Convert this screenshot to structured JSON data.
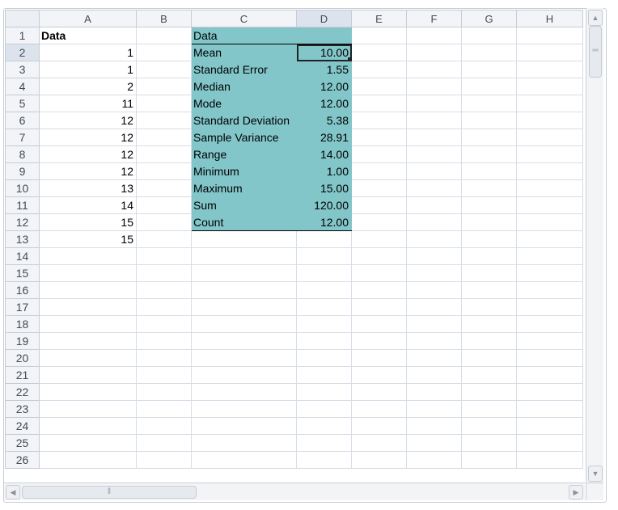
{
  "columns": [
    "A",
    "B",
    "C",
    "D",
    "E",
    "F",
    "G",
    "H"
  ],
  "rows": [
    "1",
    "2",
    "3",
    "4",
    "5",
    "6",
    "7",
    "8",
    "9",
    "10",
    "11",
    "12",
    "13",
    "14",
    "15",
    "16",
    "17",
    "18",
    "19",
    "20",
    "21",
    "22",
    "23",
    "24",
    "25",
    "26"
  ],
  "active_cell": "D2",
  "colors": {
    "stats_fill": "#82c6c9",
    "header_bg": "#f2f4f7",
    "grid_line": "#d7dde6"
  },
  "cells": {
    "A1": "Data",
    "A2": "1",
    "A3": "1",
    "A4": "2",
    "A5": "11",
    "A6": "12",
    "A7": "12",
    "A8": "12",
    "A9": "12",
    "A10": "13",
    "A11": "14",
    "A12": "15",
    "A13": "15",
    "C1": "Data",
    "C2": "Mean",
    "D2": "10.00",
    "C3": "Standard Error",
    "D3": "1.55",
    "C4": "Median",
    "D4": "12.00",
    "C5": "Mode",
    "D5": "12.00",
    "C6": "Standard Deviation",
    "D6": "5.38",
    "C7": "Sample Variance",
    "D7": "28.91",
    "C8": "Range",
    "D8": "14.00",
    "C9": "Minimum",
    "D9": "1.00",
    "C10": "Maximum",
    "D10": "15.00",
    "C11": "Sum",
    "D11": "120.00",
    "C12": "Count",
    "D12": "12.00"
  },
  "scrollbars": {
    "up_icon": "▲",
    "down_icon": "▼",
    "left_icon": "◀",
    "right_icon": "▶",
    "v_grip": "═",
    "h_grip": "‖"
  }
}
